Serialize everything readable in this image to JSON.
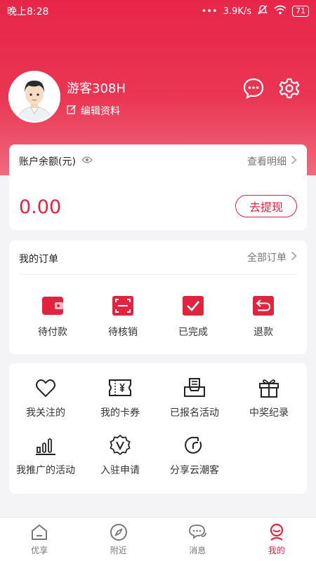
{
  "status_bar": {
    "time": "晚上8:28",
    "dots": "•••",
    "speed": "3.9K/s",
    "battery": "71"
  },
  "profile": {
    "username": "游客308H",
    "edit_label": "编辑资料"
  },
  "balance": {
    "label": "账户余额(元)",
    "detail_link": "查看明细",
    "amount": "0.00",
    "withdraw_button": "去提现"
  },
  "orders": {
    "title": "我的订单",
    "all_link": "全部订单",
    "items": [
      {
        "label": "待付款",
        "icon": "wallet-icon"
      },
      {
        "label": "待核销",
        "icon": "scan-icon"
      },
      {
        "label": "已完成",
        "icon": "check-icon"
      },
      {
        "label": "退款",
        "icon": "return-icon"
      }
    ]
  },
  "services": {
    "items": [
      {
        "label": "我关注的",
        "icon": "heart-icon"
      },
      {
        "label": "我的卡券",
        "icon": "coupon-icon"
      },
      {
        "label": "已报名活动",
        "icon": "inbox-icon"
      },
      {
        "label": "中奖纪录",
        "icon": "gift-icon"
      },
      {
        "label": "我推广的活动",
        "icon": "bar-chart-icon"
      },
      {
        "label": "入驻申请",
        "icon": "badge-v-icon"
      },
      {
        "label": "分享云潮客",
        "icon": "share-icon"
      }
    ]
  },
  "tabbar": {
    "items": [
      {
        "label": "优享",
        "icon": "home-icon"
      },
      {
        "label": "附近",
        "icon": "compass-icon"
      },
      {
        "label": "消息",
        "icon": "chat-icon"
      },
      {
        "label": "我的",
        "icon": "profile-icon"
      }
    ],
    "active": "我的"
  },
  "colors": {
    "brand": "#e0243f",
    "header_top": "#e8264a",
    "background": "#f4f4f6"
  }
}
